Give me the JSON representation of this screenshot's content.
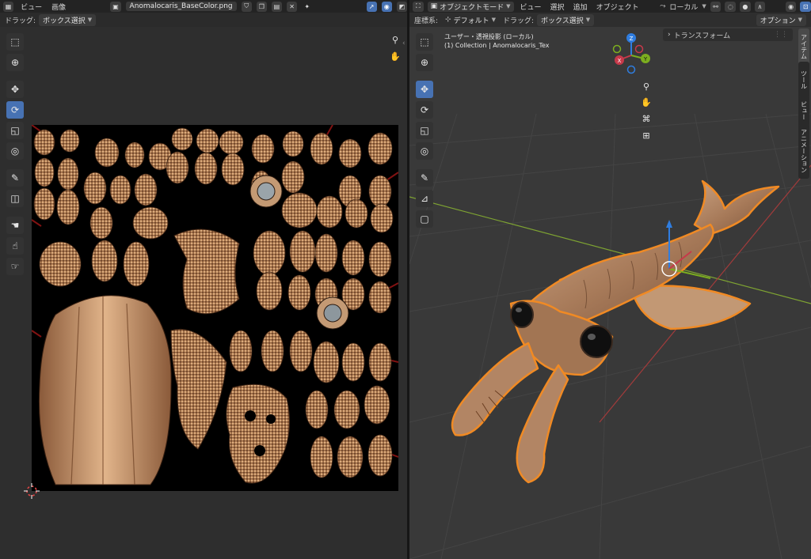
{
  "image_editor": {
    "header": {
      "menus": [
        "ビュー",
        "画像"
      ],
      "image_name": "Anomalocaris_BaseColor.png"
    },
    "header2": {
      "drag_label": "ドラッグ:",
      "drag_value": "ボックス選択"
    },
    "tools": [
      "select-box",
      "cursor",
      "move",
      "rotate",
      "scale",
      "transform",
      "annotate",
      "sample",
      "grab",
      "relax",
      "pinch"
    ]
  },
  "viewport": {
    "header": {
      "mode": "オブジェクトモード",
      "menus": [
        "ビュー",
        "選択",
        "追加",
        "オブジェクト"
      ],
      "pivot": "ローカル"
    },
    "header2": {
      "orient_label": "座標系:",
      "orient_value": "デフォルト",
      "drag_label": "ドラッグ:",
      "drag_value": "ボックス選択",
      "options": "オプション"
    },
    "overlay": {
      "line1": "ユーザー・透視投影 (ローカル)",
      "line2": "(1) Collection | Anomalocaris_Tex"
    },
    "transform_panel": "トランスフォーム",
    "side_tabs": [
      "アイテム",
      "ツール",
      "ビュー",
      "アニメーション"
    ],
    "gizmo": {
      "z": "Z",
      "y": "Y",
      "x": "X"
    },
    "colors": {
      "axis_x": "#c7394a",
      "axis_y": "#7cae1f",
      "axis_z": "#2f7de0",
      "outline": "#f08a24",
      "active": "#4772b3"
    }
  }
}
